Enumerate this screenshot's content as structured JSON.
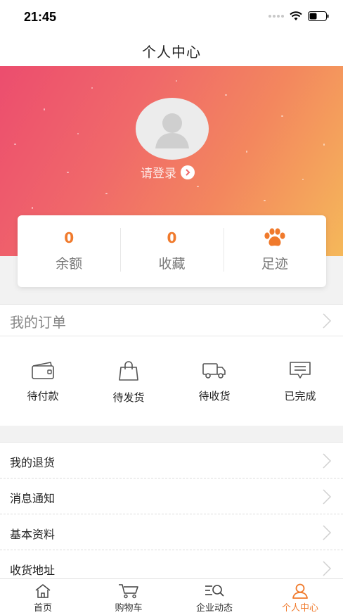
{
  "status_bar": {
    "time": "21:45"
  },
  "nav": {
    "title": "个人中心"
  },
  "profile": {
    "login_text": "请登录"
  },
  "stats": [
    {
      "value": "0",
      "label": "余额"
    },
    {
      "value": "0",
      "label": "收藏"
    },
    {
      "value": "",
      "label": "足迹",
      "icon": "paw-icon"
    }
  ],
  "orders": {
    "title": "我的订单",
    "items": [
      {
        "label": "待付款",
        "icon": "wallet-icon"
      },
      {
        "label": "待发货",
        "icon": "bag-icon"
      },
      {
        "label": "待收货",
        "icon": "truck-icon"
      },
      {
        "label": "已完成",
        "icon": "message-icon"
      }
    ]
  },
  "menu": [
    {
      "label": "我的退货"
    },
    {
      "label": "消息通知"
    },
    {
      "label": "基本资料"
    },
    {
      "label": "收货地址"
    }
  ],
  "tabs": [
    {
      "label": "首页",
      "icon": "home-icon"
    },
    {
      "label": "购物车",
      "icon": "cart-icon"
    },
    {
      "label": "企业动态",
      "icon": "news-search-icon"
    },
    {
      "label": "个人中心",
      "icon": "user-icon"
    }
  ],
  "colors": {
    "accent": "#f07a2c",
    "banner_start": "#ec4d6e",
    "banner_end": "#f5b85a"
  }
}
